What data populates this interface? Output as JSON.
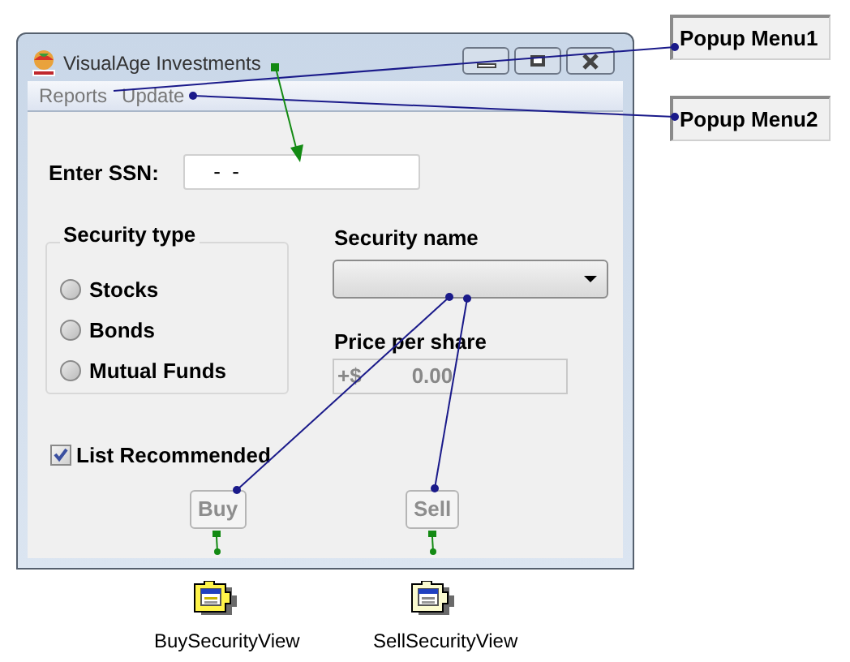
{
  "window": {
    "title": "VisualAge Investments"
  },
  "menu": [
    {
      "label": "Reports"
    },
    {
      "label": "Update"
    }
  ],
  "ssn": {
    "label": "Enter SSN:",
    "value": " -  -"
  },
  "security_type": {
    "title": "Security type",
    "options": [
      {
        "label": "Stocks",
        "selected": false
      },
      {
        "label": "Bonds",
        "selected": false
      },
      {
        "label": "Mutual Funds",
        "selected": false
      }
    ]
  },
  "security_name": {
    "label": "Security name"
  },
  "price": {
    "label": "Price per share",
    "prefix": "+$",
    "value": "0.00"
  },
  "list_recommended": {
    "label": "List Recommended",
    "checked": true
  },
  "buttons": [
    {
      "label": "Buy",
      "disabled": true
    },
    {
      "label": "Sell",
      "disabled": true
    }
  ],
  "parts": [
    {
      "label": "BuySecurityView"
    },
    {
      "label": "SellSecurityView"
    }
  ],
  "popup_menus": [
    {
      "label": "Popup Menu1"
    },
    {
      "label": "Popup Menu2"
    }
  ]
}
